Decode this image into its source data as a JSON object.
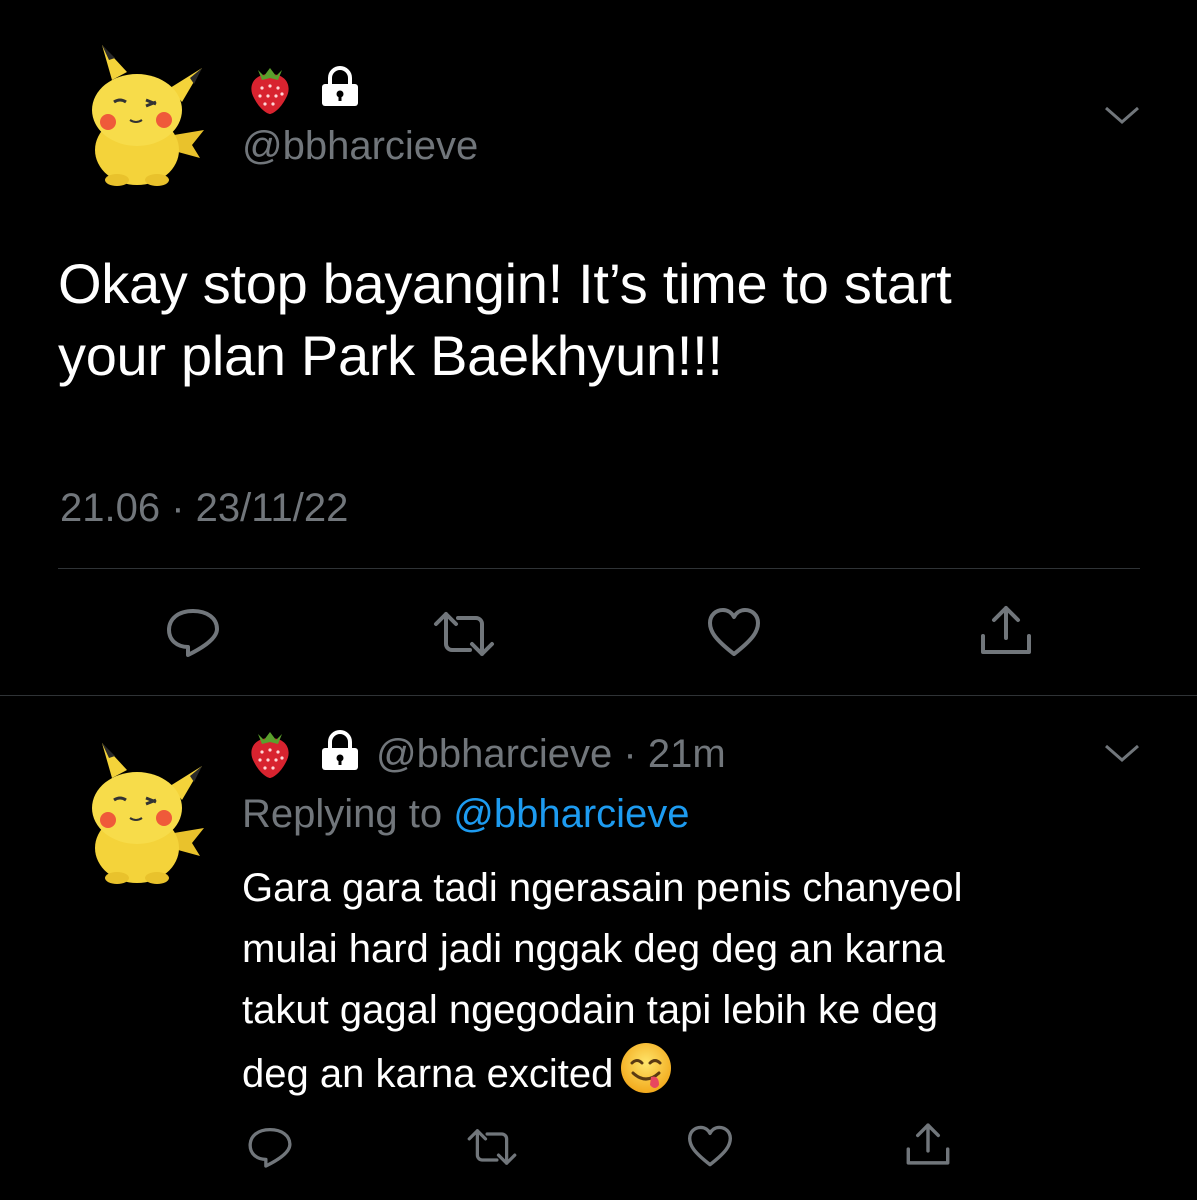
{
  "tweet": {
    "strawberry_icon": "strawberry-emoji",
    "lock_icon": "lock-icon",
    "handle": "@bbharcieve",
    "text_line1": "Okay stop bayangin! It’s time to start",
    "text_line2": "your plan Park Baekhyun!!!",
    "timestamp": "21.06 · 23/11/22",
    "actions": [
      "reply-icon",
      "retweet-icon",
      "like-icon",
      "share-icon"
    ]
  },
  "reply": {
    "handle": "@bbharcieve",
    "time": "· 21m",
    "replying_label": "Replying to",
    "replying_handle": "@bbharcieve",
    "text_line1": "Gara gara tadi ngerasain penis chanyeol",
    "text_line2": "mulai hard jadi nggak deg deg an karna",
    "text_line3": "takut gagal ngegodain tapi lebih ke deg",
    "text_line4": "deg an karna excited",
    "emoji": "yum-face-emoji",
    "actions": [
      "reply-icon",
      "retweet-icon",
      "like-icon",
      "share-icon"
    ]
  },
  "colors": {
    "background": "#000000",
    "text": "#ffffff",
    "muted": "#71767b",
    "link": "#1d9bf0",
    "divider": "#2f3336"
  }
}
